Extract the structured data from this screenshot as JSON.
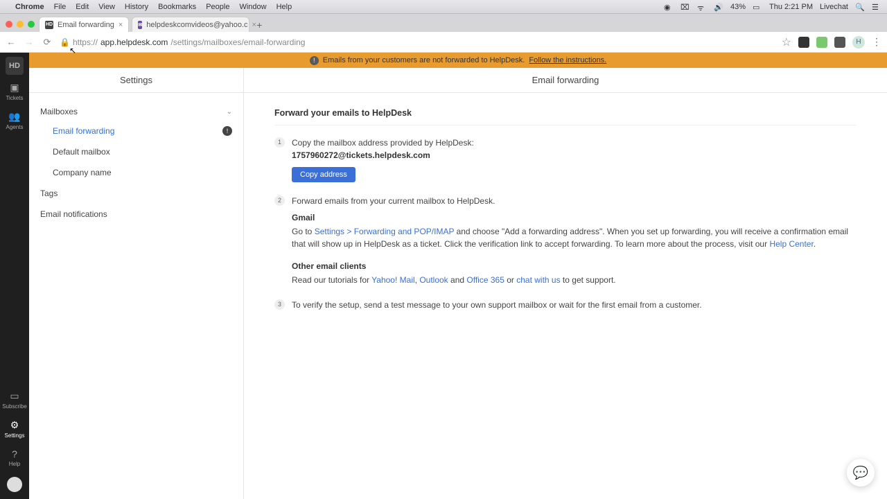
{
  "menubar": {
    "app": "Chrome",
    "items": [
      "File",
      "Edit",
      "View",
      "History",
      "Bookmarks",
      "People",
      "Window",
      "Help"
    ],
    "battery": "43%",
    "clock": "Thu 2:21 PM",
    "user": "Livechat"
  },
  "tabs": {
    "active": {
      "title": "Email forwarding",
      "favicon": "HD"
    },
    "other": {
      "title": "helpdeskcomvideos@yahoo.c"
    }
  },
  "url": {
    "host": "app.helpdesk.com",
    "path": "/settings/mailboxes/email-forwarding",
    "scheme": "https://"
  },
  "avatar_initial": "H",
  "banner": {
    "text": "Emails from your customers are not forwarded to HelpDesk.",
    "link": "Follow the instructions."
  },
  "rail": {
    "logo": "HD",
    "items": [
      {
        "label": "Tickets",
        "icon": "🎟"
      },
      {
        "label": "Agents",
        "icon": "👥"
      }
    ],
    "bottom": [
      {
        "label": "Subscribe",
        "icon": "💳"
      },
      {
        "label": "Settings",
        "icon": "⚙"
      },
      {
        "label": "Help",
        "icon": "?"
      }
    ]
  },
  "settings": {
    "title": "Settings",
    "groups": {
      "mailboxes": {
        "label": "Mailboxes",
        "expanded": true,
        "items": [
          {
            "label": "Email forwarding",
            "active": true,
            "alert": true
          },
          {
            "label": "Default mailbox"
          },
          {
            "label": "Company name"
          }
        ]
      },
      "tags": {
        "label": "Tags"
      },
      "notifications": {
        "label": "Email notifications"
      }
    }
  },
  "main": {
    "title": "Email forwarding",
    "section": "Forward your emails to HelpDesk",
    "step1": {
      "text": "Copy the mailbox address provided by HelpDesk:",
      "address": "1757960272@tickets.helpdesk.com",
      "button": "Copy address"
    },
    "step2": {
      "text": "Forward emails from your current mailbox to HelpDesk.",
      "gmail_h": "Gmail",
      "gmail_pre": "Go to ",
      "gmail_link": "Settings > Forwarding and POP/IMAP",
      "gmail_post": " and choose \"Add a forwarding address\". When you set up forwarding, you will receive a confirmation email that will show up in HelpDesk as a ticket. Click the verification link to accept forwarding. To learn more about the process, visit our ",
      "help_center": "Help Center",
      "other_h": "Other email clients",
      "other_pre": "Read our tutorials for ",
      "yahoo": "Yahoo! Mail",
      "outlook": "Outlook",
      "and": " and ",
      "office": "Office 365",
      "or": " or ",
      "chat": "chat with us",
      "other_post": " to get support."
    },
    "step3": {
      "text": "To verify the setup, send a test message to your own support mailbox or wait for the first email from a customer."
    }
  }
}
